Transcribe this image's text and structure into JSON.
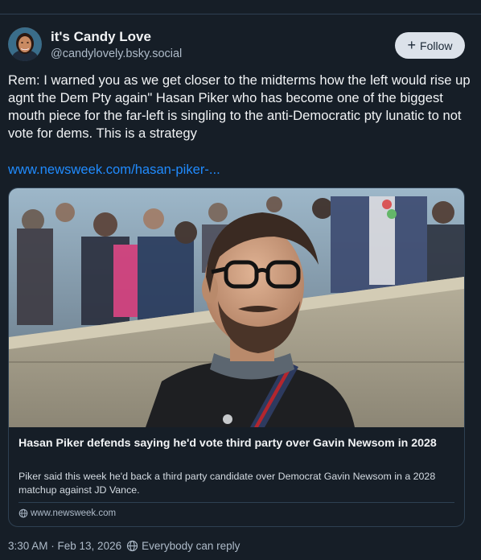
{
  "author": {
    "display_name": "it's Candy Love",
    "handle": "@candylovely.bsky.social",
    "avatar_icon": "user-avatar"
  },
  "follow_button": {
    "label": "Follow",
    "icon": "plus-icon"
  },
  "post": {
    "text": "Rem: I warned you as we get closer to the midterms how the left would rise up agnt the Dem Pty again\" Hasan Piker who has become one of the biggest mouth piece for the far-left is singling to the anti-Democratic pty lunatic to not vote for dems. This is a strategy",
    "link_text": "www.newsweek.com/hasan-piker-..."
  },
  "link_card": {
    "title": "Hasan Piker defends saying he'd vote third party over Gavin Newsom in 2028",
    "description": "Piker said this week he'd back a third party candidate over Democrat Gavin Newsom in a 2028 matchup against JD Vance.",
    "domain": "www.newsweek.com",
    "domain_icon": "globe-icon"
  },
  "footer": {
    "timestamp": "3:30 AM · Feb 13, 2026",
    "reply_setting": "Everybody can reply",
    "reply_icon": "globe-icon"
  },
  "colors": {
    "background": "#161e27",
    "link": "#208bfe",
    "border": "#2e4052",
    "secondary_text": "#aebbc9",
    "follow_button_bg": "#dce2ea"
  }
}
